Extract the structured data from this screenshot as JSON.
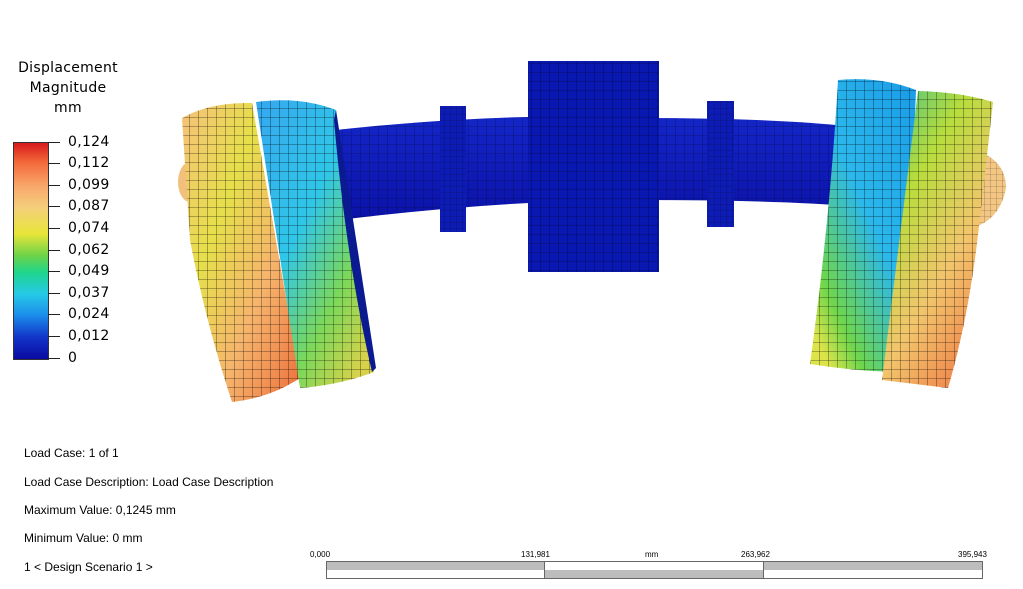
{
  "legend": {
    "title_line1": "Displacement",
    "title_line2": "Magnitude",
    "unit": "mm",
    "ticks": [
      "0,124",
      "0,112",
      "0,099",
      "0,087",
      "0,074",
      "0,062",
      "0,049",
      "0,037",
      "0,024",
      "0,012",
      "0"
    ],
    "max_color": "#d7191c",
    "min_color": "#0a0aa0"
  },
  "info": {
    "load_case": "Load Case:  1 of 1",
    "load_case_description": "Load Case Description:  Load Case Description",
    "maximum_value": "Maximum Value: 0,1245 mm",
    "minimum_value": "Minimum Value: 0 mm",
    "design_scenario": "1 < Design Scenario 1 >"
  },
  "scale_bar": {
    "labels": [
      "0,000",
      "131,981",
      "263,962",
      "395,943"
    ],
    "unit": "mm"
  }
}
